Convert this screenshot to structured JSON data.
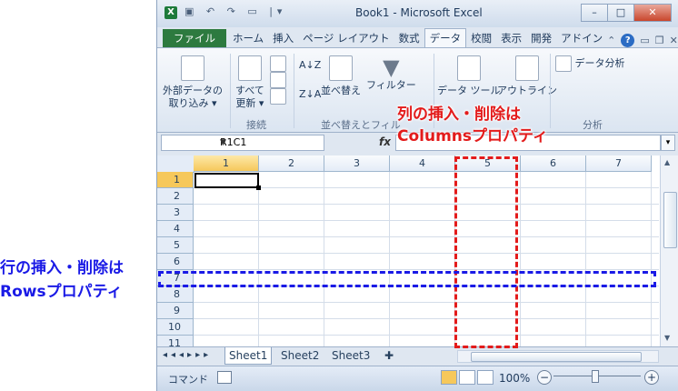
{
  "window": {
    "title": "Book1 - Microsoft Excel",
    "controls": [
      "–",
      "□",
      "✕"
    ]
  },
  "ribbon_tabs": [
    "ファイル",
    "ホーム",
    "挿入",
    "ページ レイアウト",
    "数式",
    "データ",
    "校閲",
    "表示",
    "開発",
    "アドイン"
  ],
  "active_tab": "データ",
  "ribbon": {
    "external_data": "外部データの",
    "external_data_2": "取り込み ▾",
    "refresh_all": "すべて",
    "refresh_all_2": "更新 ▾",
    "group_connections": "接続",
    "sort": "並べ替え",
    "filter": "フィルター",
    "group_sort_filter": "並べ替えとフィル",
    "data_tools": "データ ツール",
    "outline": "アウトライン",
    "data_analysis": "データ分析",
    "group_analysis": "分析"
  },
  "formula_bar": {
    "name_box": "R1C1",
    "fx": "fx"
  },
  "columns": [
    "1",
    "2",
    "3",
    "4",
    "5",
    "6",
    "7"
  ],
  "selected_column": "1",
  "rows": [
    "1",
    "2",
    "3",
    "4",
    "5",
    "6",
    "7",
    "8",
    "9",
    "10",
    "11"
  ],
  "selected_row": "1",
  "sheets": [
    "Sheet1",
    "Sheet2",
    "Sheet3"
  ],
  "active_sheet": "Sheet1",
  "status": {
    "mode": "コマンド",
    "zoom": "100%"
  },
  "annotations": {
    "columns_line1": "列の挿入・削除は",
    "columns_line2": "Columnsプロパティ",
    "rows_line1": "行の挿入・削除は",
    "rows_line2": "Rowsプロパティ"
  },
  "colors": {
    "annotation_red": "#e31b1b",
    "annotation_blue": "#1a1ae6",
    "file_tab": "#2d7a3f",
    "selected_header": "#f6c85b"
  }
}
